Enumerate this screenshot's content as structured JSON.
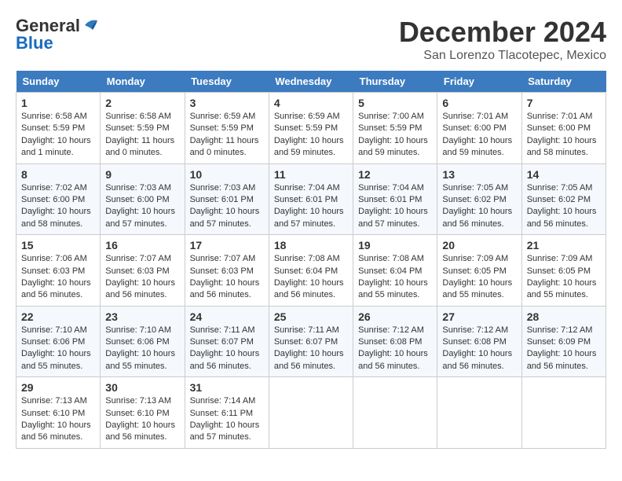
{
  "header": {
    "logo_line1": "General",
    "logo_line2": "Blue",
    "month": "December 2024",
    "location": "San Lorenzo Tlacotepec, Mexico"
  },
  "days_of_week": [
    "Sunday",
    "Monday",
    "Tuesday",
    "Wednesday",
    "Thursday",
    "Friday",
    "Saturday"
  ],
  "weeks": [
    [
      {
        "day": 1,
        "sunrise": "6:58 AM",
        "sunset": "5:59 PM",
        "daylight": "10 hours and 1 minute."
      },
      {
        "day": 2,
        "sunrise": "6:58 AM",
        "sunset": "5:59 PM",
        "daylight": "11 hours and 0 minutes."
      },
      {
        "day": 3,
        "sunrise": "6:59 AM",
        "sunset": "5:59 PM",
        "daylight": "11 hours and 0 minutes."
      },
      {
        "day": 4,
        "sunrise": "6:59 AM",
        "sunset": "5:59 PM",
        "daylight": "10 hours and 59 minutes."
      },
      {
        "day": 5,
        "sunrise": "7:00 AM",
        "sunset": "5:59 PM",
        "daylight": "10 hours and 59 minutes."
      },
      {
        "day": 6,
        "sunrise": "7:01 AM",
        "sunset": "6:00 PM",
        "daylight": "10 hours and 59 minutes."
      },
      {
        "day": 7,
        "sunrise": "7:01 AM",
        "sunset": "6:00 PM",
        "daylight": "10 hours and 58 minutes."
      }
    ],
    [
      {
        "day": 8,
        "sunrise": "7:02 AM",
        "sunset": "6:00 PM",
        "daylight": "10 hours and 58 minutes."
      },
      {
        "day": 9,
        "sunrise": "7:03 AM",
        "sunset": "6:00 PM",
        "daylight": "10 hours and 57 minutes."
      },
      {
        "day": 10,
        "sunrise": "7:03 AM",
        "sunset": "6:01 PM",
        "daylight": "10 hours and 57 minutes."
      },
      {
        "day": 11,
        "sunrise": "7:04 AM",
        "sunset": "6:01 PM",
        "daylight": "10 hours and 57 minutes."
      },
      {
        "day": 12,
        "sunrise": "7:04 AM",
        "sunset": "6:01 PM",
        "daylight": "10 hours and 57 minutes."
      },
      {
        "day": 13,
        "sunrise": "7:05 AM",
        "sunset": "6:02 PM",
        "daylight": "10 hours and 56 minutes."
      },
      {
        "day": 14,
        "sunrise": "7:05 AM",
        "sunset": "6:02 PM",
        "daylight": "10 hours and 56 minutes."
      }
    ],
    [
      {
        "day": 15,
        "sunrise": "7:06 AM",
        "sunset": "6:03 PM",
        "daylight": "10 hours and 56 minutes."
      },
      {
        "day": 16,
        "sunrise": "7:07 AM",
        "sunset": "6:03 PM",
        "daylight": "10 hours and 56 minutes."
      },
      {
        "day": 17,
        "sunrise": "7:07 AM",
        "sunset": "6:03 PM",
        "daylight": "10 hours and 56 minutes."
      },
      {
        "day": 18,
        "sunrise": "7:08 AM",
        "sunset": "6:04 PM",
        "daylight": "10 hours and 56 minutes."
      },
      {
        "day": 19,
        "sunrise": "7:08 AM",
        "sunset": "6:04 PM",
        "daylight": "10 hours and 55 minutes."
      },
      {
        "day": 20,
        "sunrise": "7:09 AM",
        "sunset": "6:05 PM",
        "daylight": "10 hours and 55 minutes."
      },
      {
        "day": 21,
        "sunrise": "7:09 AM",
        "sunset": "6:05 PM",
        "daylight": "10 hours and 55 minutes."
      }
    ],
    [
      {
        "day": 22,
        "sunrise": "7:10 AM",
        "sunset": "6:06 PM",
        "daylight": "10 hours and 55 minutes."
      },
      {
        "day": 23,
        "sunrise": "7:10 AM",
        "sunset": "6:06 PM",
        "daylight": "10 hours and 55 minutes."
      },
      {
        "day": 24,
        "sunrise": "7:11 AM",
        "sunset": "6:07 PM",
        "daylight": "10 hours and 56 minutes."
      },
      {
        "day": 25,
        "sunrise": "7:11 AM",
        "sunset": "6:07 PM",
        "daylight": "10 hours and 56 minutes."
      },
      {
        "day": 26,
        "sunrise": "7:12 AM",
        "sunset": "6:08 PM",
        "daylight": "10 hours and 56 minutes."
      },
      {
        "day": 27,
        "sunrise": "7:12 AM",
        "sunset": "6:08 PM",
        "daylight": "10 hours and 56 minutes."
      },
      {
        "day": 28,
        "sunrise": "7:12 AM",
        "sunset": "6:09 PM",
        "daylight": "10 hours and 56 minutes."
      }
    ],
    [
      {
        "day": 29,
        "sunrise": "7:13 AM",
        "sunset": "6:10 PM",
        "daylight": "10 hours and 56 minutes."
      },
      {
        "day": 30,
        "sunrise": "7:13 AM",
        "sunset": "6:10 PM",
        "daylight": "10 hours and 56 minutes."
      },
      {
        "day": 31,
        "sunrise": "7:14 AM",
        "sunset": "6:11 PM",
        "daylight": "10 hours and 57 minutes."
      },
      null,
      null,
      null,
      null
    ]
  ]
}
